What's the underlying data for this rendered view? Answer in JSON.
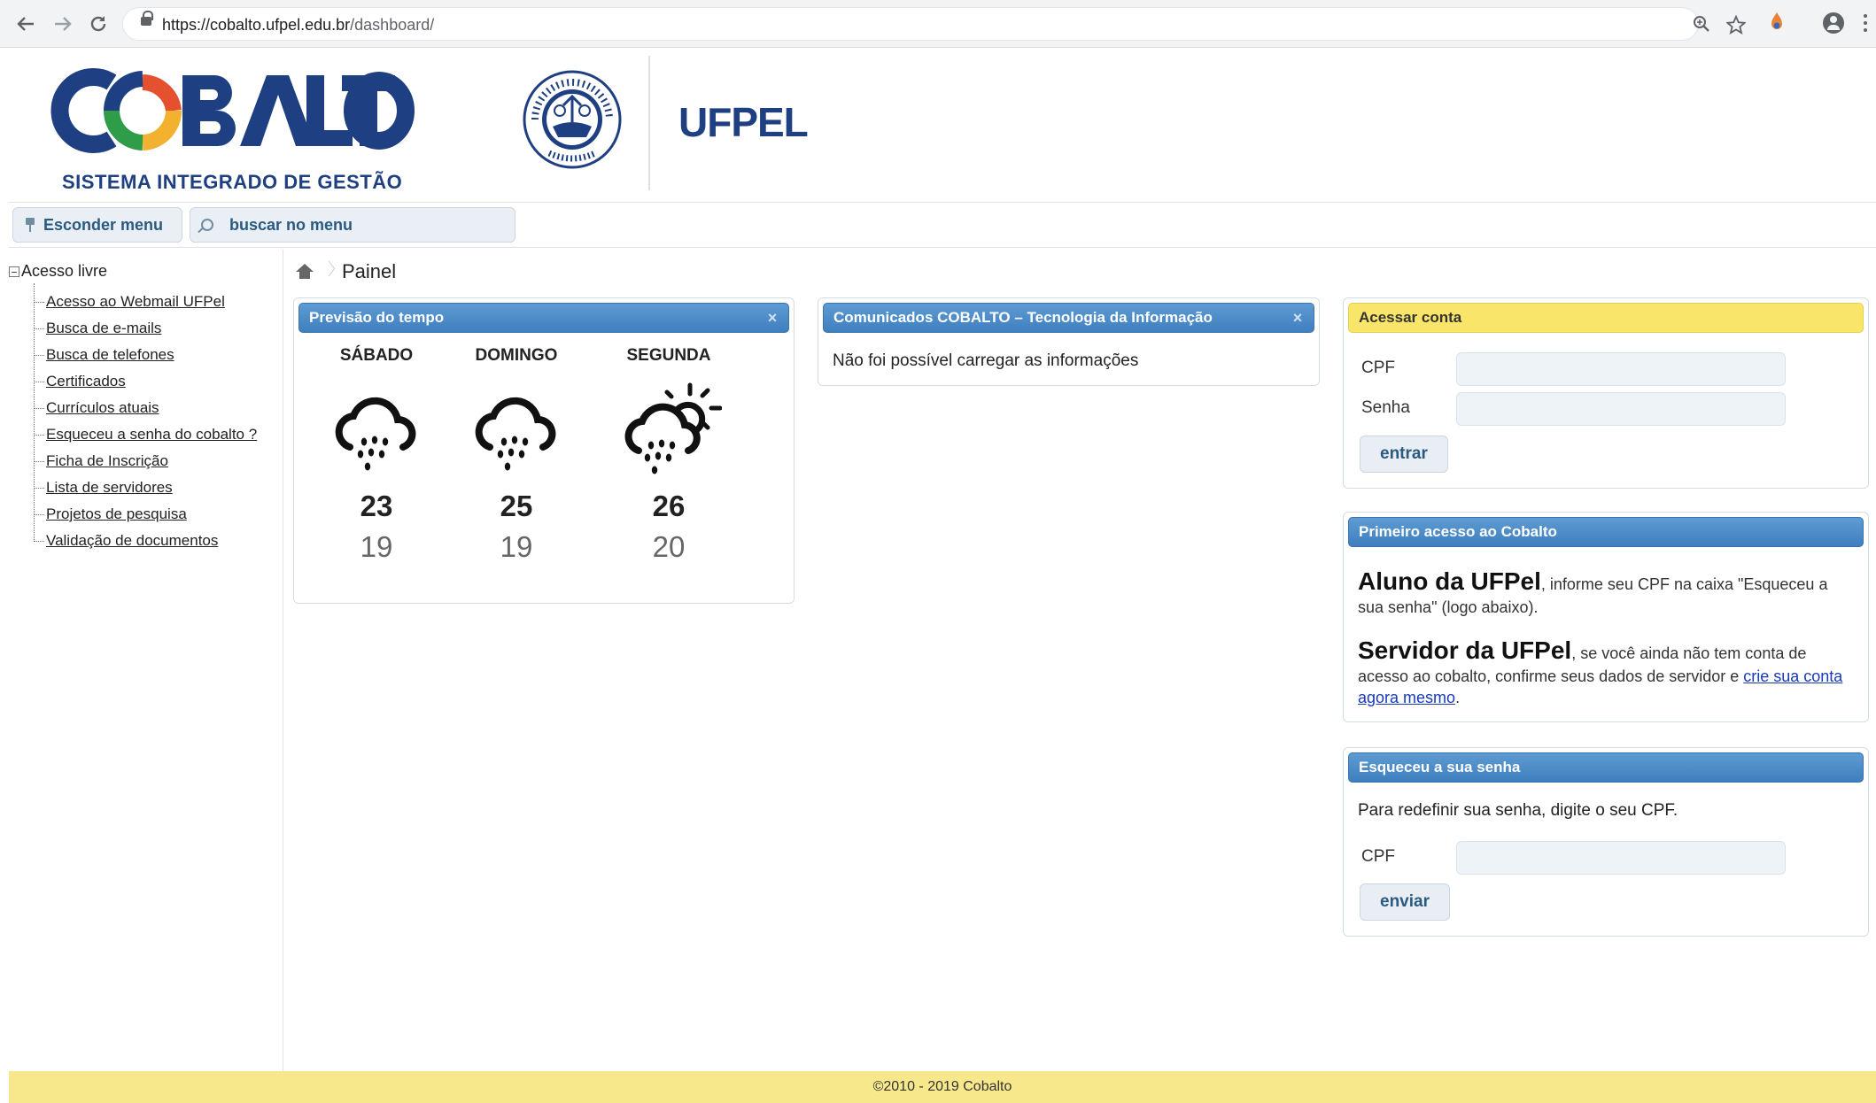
{
  "browser": {
    "url_host": "https://cobalto.ufpel.edu.br",
    "url_path": "/dashboard/"
  },
  "header": {
    "logo_text": "COBALTO",
    "logo_subtitle": "SISTEMA INTEGRADO DE GESTÃO",
    "seal_text": "UNIVERSIDADE FEDERAL DE PELOTAS · RS-BRASIL",
    "institution": "UFPEL"
  },
  "toolbar": {
    "hide_menu_label": "Esconder menu",
    "search_placeholder": "buscar no menu"
  },
  "sidebar": {
    "root_label": "Acesso livre",
    "items": [
      {
        "label": "Acesso ao Webmail UFPel"
      },
      {
        "label": "Busca de e-mails"
      },
      {
        "label": "Busca de telefones"
      },
      {
        "label": "Certificados"
      },
      {
        "label": "Currículos atuais"
      },
      {
        "label": "Esqueceu a senha do cobalto ?"
      },
      {
        "label": "Ficha de Inscrição"
      },
      {
        "label": "Lista de servidores"
      },
      {
        "label": "Projetos de pesquisa"
      },
      {
        "label": "Validação de documentos"
      }
    ]
  },
  "breadcrumb": {
    "title": "Painel"
  },
  "weather": {
    "title": "Previsão do tempo",
    "close_symbol": "×",
    "days": [
      {
        "day": "SÁBADO",
        "max": "23",
        "min": "19",
        "icon": "rain-cloud-icon"
      },
      {
        "day": "DOMINGO",
        "max": "25",
        "min": "19",
        "icon": "rain-cloud-icon"
      },
      {
        "day": "SEGUNDA",
        "max": "26",
        "min": "20",
        "icon": "sun-rain-cloud-icon"
      }
    ]
  },
  "news": {
    "title": "Comunicados COBALTO – Tecnologia da Informação",
    "close_symbol": "×",
    "message": "Não foi possível carregar as informações"
  },
  "login": {
    "title": "Acessar conta",
    "cpf_label": "CPF",
    "cpf_value": "",
    "password_label": "Senha",
    "password_value": "",
    "submit_label": "entrar"
  },
  "first_access": {
    "title": "Primeiro acesso ao Cobalto",
    "student_heading": "Aluno da UFPel",
    "student_text": ", informe seu CPF na caixa \"Esqueceu a sua senha\" (logo abaixo).",
    "staff_heading": "Servidor da UFPel",
    "staff_text": ", se você ainda não tem conta de acesso ao cobalto, confirme seus dados de servidor e ",
    "staff_link": "crie sua conta agora mesmo",
    "staff_end": "."
  },
  "forgot": {
    "title": "Esqueceu a sua senha",
    "instructions": "Para redefinir sua senha, digite o seu CPF.",
    "cpf_label": "CPF",
    "cpf_value": "",
    "submit_label": "enviar"
  },
  "footer": {
    "copyright": "©2010 - 2019 Cobalto"
  },
  "colors": {
    "brand_blue": "#1e3f82",
    "header_blue": "#4a8ac7",
    "header_yellow": "#f9e56a",
    "footer_yellow": "#f8e88c"
  }
}
